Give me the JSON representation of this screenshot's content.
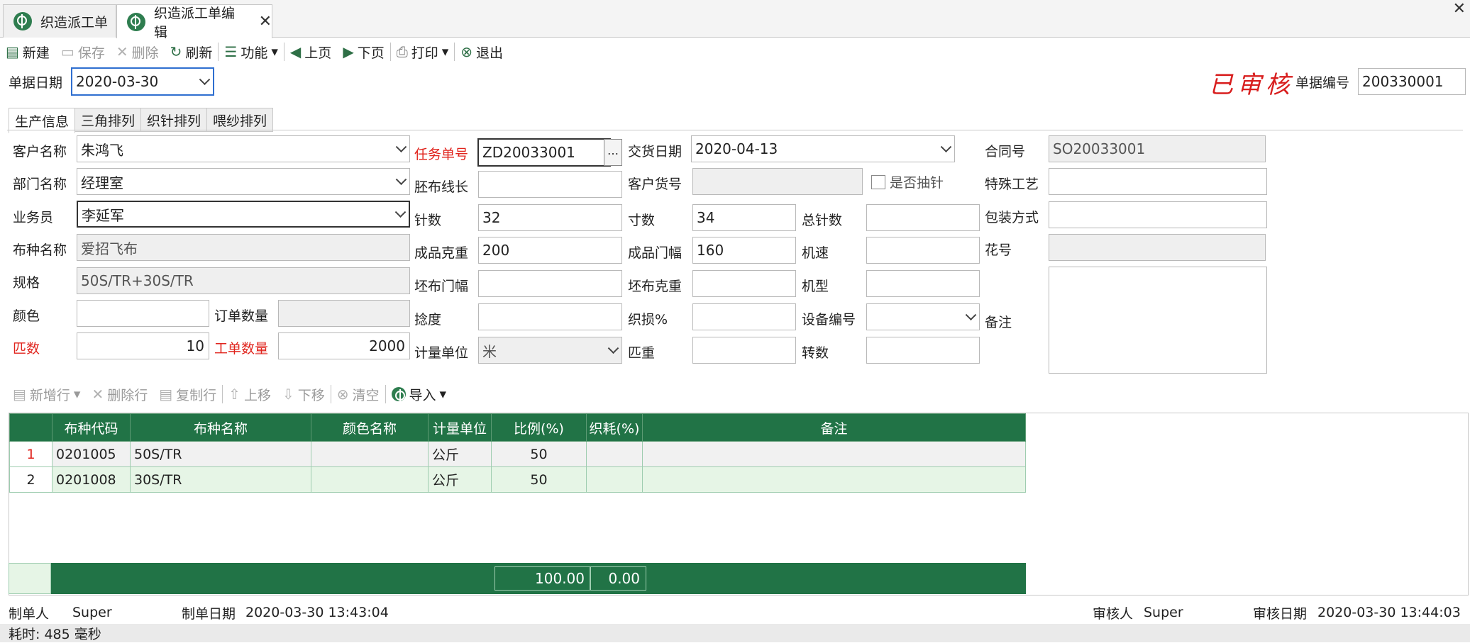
{
  "tabs": [
    {
      "label": "织造派工单"
    },
    {
      "label": "织造派工单编辑"
    }
  ],
  "toolbar": {
    "new": "新建",
    "save": "保存",
    "delete": "删除",
    "refresh": "刷新",
    "function": "功能",
    "prev": "上页",
    "next": "下页",
    "print": "打印",
    "exit": "退出"
  },
  "header": {
    "doc_date_label": "单据日期",
    "doc_date": "2020-03-30",
    "status_stamp": "已审核",
    "doc_no_label": "单据编号",
    "doc_no": "200330001"
  },
  "subtabs": [
    "生产信息",
    "三角排列",
    "织针排列",
    "喂纱排列"
  ],
  "form": {
    "customer_label": "客户名称",
    "customer": "朱鸿飞",
    "dept_label": "部门名称",
    "dept": "经理室",
    "salesman_label": "业务员",
    "salesman": "李延军",
    "fabric_label": "布种名称",
    "fabric": "爱招飞布",
    "spec_label": "规格",
    "spec": "50S/TR+30S/TR",
    "color_label": "颜色",
    "color": "",
    "order_qty_label": "订单数量",
    "order_qty": "",
    "pieces_label": "匹数",
    "pieces": "10",
    "work_qty_label": "工单数量",
    "work_qty": "2000",
    "task_no_label": "任务单号",
    "task_no": "ZD20033001",
    "loop_len_label": "胚布线长",
    "loop_len": "",
    "needles_label": "针数",
    "needles": "32",
    "weight_label": "成品克重",
    "weight": "200",
    "grey_width_label": "坯布门幅",
    "grey_width": "",
    "twist_label": "捻度",
    "twist": "",
    "unit_label": "计量单位",
    "unit": "米",
    "delivery_label": "交货日期",
    "delivery": "2020-04-13",
    "cust_item_label": "客户货号",
    "cust_item": "",
    "sample_label": "是否抽针",
    "inch_label": "寸数",
    "inch": "34",
    "total_needles_label": "总针数",
    "total_needles": "",
    "width_label": "成品门幅",
    "width": "160",
    "speed_label": "机速",
    "speed": "",
    "grey_weight_label": "坯布克重",
    "grey_weight": "",
    "machine_type_label": "机型",
    "machine_type": "",
    "loss_label": "织损%",
    "loss": "",
    "equip_no_label": "设备编号",
    "equip_no": "",
    "piece_weight_label": "匹重",
    "piece_weight": "",
    "turns_label": "转数",
    "turns": "",
    "contract_label": "合同号",
    "contract": "SO20033001",
    "special_label": "特殊工艺",
    "special": "",
    "packing_label": "包装方式",
    "packing": "",
    "pattern_label": "花号",
    "pattern": "",
    "remark_label": "备注",
    "remark": ""
  },
  "grid_toolbar": {
    "add_row": "新增行",
    "del_row": "删除行",
    "copy_row": "复制行",
    "move_up": "上移",
    "move_down": "下移",
    "clear": "清空",
    "import": "导入"
  },
  "grid": {
    "columns": [
      "布种代码",
      "布种名称",
      "颜色名称",
      "计量单位",
      "比例(%)",
      "织耗(%)",
      "备注"
    ],
    "rows": [
      {
        "no": "1",
        "code": "0201005",
        "name": "50S/TR",
        "color": "",
        "unit": "公斤",
        "ratio": "50",
        "loss": "",
        "remark": ""
      },
      {
        "no": "2",
        "code": "0201008",
        "name": "30S/TR",
        "color": "",
        "unit": "公斤",
        "ratio": "50",
        "loss": "",
        "remark": ""
      }
    ],
    "total_ratio": "100.00",
    "total_loss": "0.00"
  },
  "footer": {
    "maker_label": "制单人",
    "maker": "Super",
    "make_date_label": "制单日期",
    "make_date": "2020-03-30 13:43:04",
    "auditor_label": "审核人",
    "auditor": "Super",
    "audit_date_label": "审核日期",
    "audit_date": "2020-03-30 13:44:03"
  },
  "status_bar": "耗时: 485 毫秒"
}
